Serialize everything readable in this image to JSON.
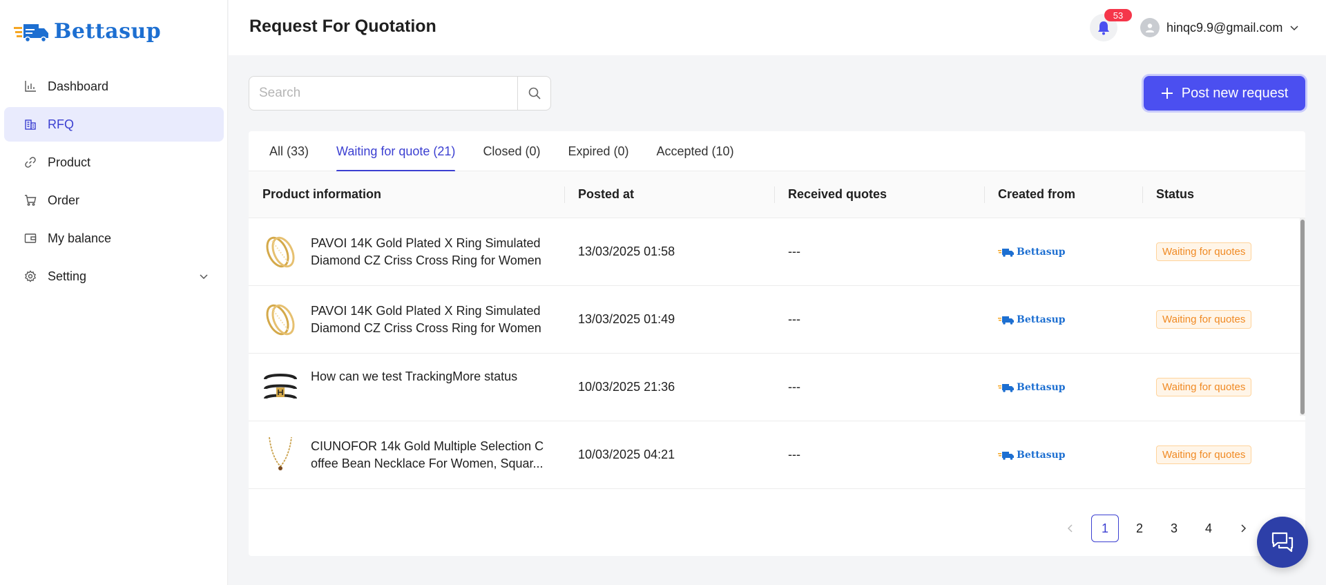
{
  "brand": {
    "name": "Bettasup",
    "accent": "#1d6fd1",
    "primary": "#4b4ff0"
  },
  "sidebar": {
    "items": [
      {
        "label": "Dashboard",
        "icon": "chart-icon"
      },
      {
        "label": "RFQ",
        "icon": "building-icon",
        "active": true
      },
      {
        "label": "Product",
        "icon": "link-icon"
      },
      {
        "label": "Order",
        "icon": "cart-icon"
      },
      {
        "label": "My balance",
        "icon": "wallet-icon"
      },
      {
        "label": "Setting",
        "icon": "gear-icon"
      }
    ]
  },
  "header": {
    "title": "Request For Quotation",
    "notification_count": "53",
    "user_email": "hinqc9.9@gmail.com"
  },
  "toolbar": {
    "search_placeholder": "Search",
    "search_value": "",
    "post_label": "Post new request"
  },
  "tabs": [
    {
      "label": "All (33)"
    },
    {
      "label": "Waiting for quote (21)",
      "active": true
    },
    {
      "label": "Closed (0)"
    },
    {
      "label": "Expired (0)"
    },
    {
      "label": "Accepted (10)"
    }
  ],
  "table": {
    "columns": [
      "Product information",
      "Posted at",
      "Received quotes",
      "Created from",
      "Status"
    ],
    "rows": [
      {
        "product": "PAVOI 14K Gold Plated X Ring Simulated Diamond CZ Criss Cross Ring for Women",
        "posted_at": "13/03/2025 01:58",
        "received_quotes": "---",
        "created_from": "Bettasup",
        "status": "Waiting for quotes"
      },
      {
        "product": "PAVOI 14K Gold Plated X Ring Simulated Diamond CZ Criss Cross Ring for Women",
        "posted_at": "13/03/2025 01:49",
        "received_quotes": "---",
        "created_from": "Bettasup",
        "status": "Waiting for quotes"
      },
      {
        "product": "How can we test TrackingMore status",
        "posted_at": "10/03/2025 21:36",
        "received_quotes": "---",
        "created_from": "Bettasup",
        "status": "Waiting for quotes"
      },
      {
        "product": "CIUNOFOR 14k Gold Multiple Selection C offee Bean Necklace For Women, Squar...",
        "posted_at": "10/03/2025 04:21",
        "received_quotes": "---",
        "created_from": "Bettasup",
        "status": "Waiting for quotes"
      }
    ]
  },
  "pagination": {
    "pages": [
      "1",
      "2",
      "3",
      "4"
    ],
    "current": "1"
  }
}
